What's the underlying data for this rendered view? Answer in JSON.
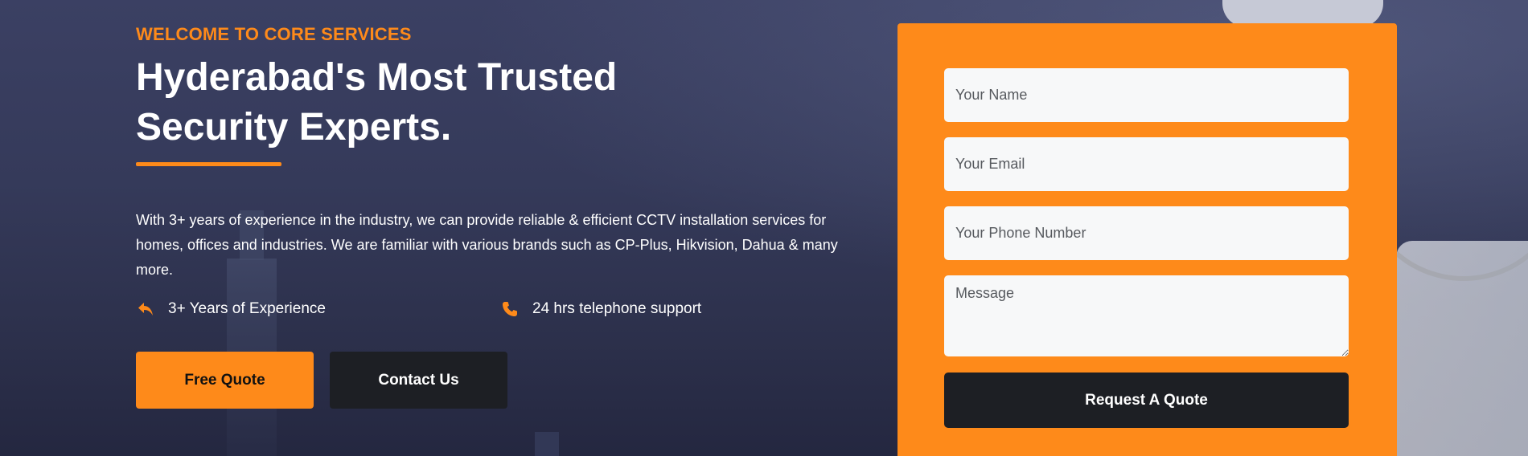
{
  "hero": {
    "eyebrow": "WELCOME TO CORE SERVICES",
    "title": "Hyderabad's Most Trusted Security Experts.",
    "description": "With 3+ years of experience in the industry, we can provide reliable & efficient CCTV installation services for homes, offices and industries. We are familiar with various brands such as CP-Plus, Hikvision, Dahua & many more.",
    "features": [
      {
        "icon": "reply-arrow-icon",
        "label": "3+ Years of Experience"
      },
      {
        "icon": "phone-icon",
        "label": "24 hrs telephone support"
      }
    ],
    "buttons": {
      "free_quote": "Free Quote",
      "contact_us": "Contact Us"
    }
  },
  "quote_form": {
    "name_placeholder": "Your Name",
    "email_placeholder": "Your Email",
    "phone_placeholder": "Your Phone Number",
    "message_placeholder": "Message",
    "submit_label": "Request A Quote"
  },
  "colors": {
    "accent": "#fe8a1a",
    "dark_button": "#1d1f24",
    "hero_bg": "#353a5a"
  }
}
